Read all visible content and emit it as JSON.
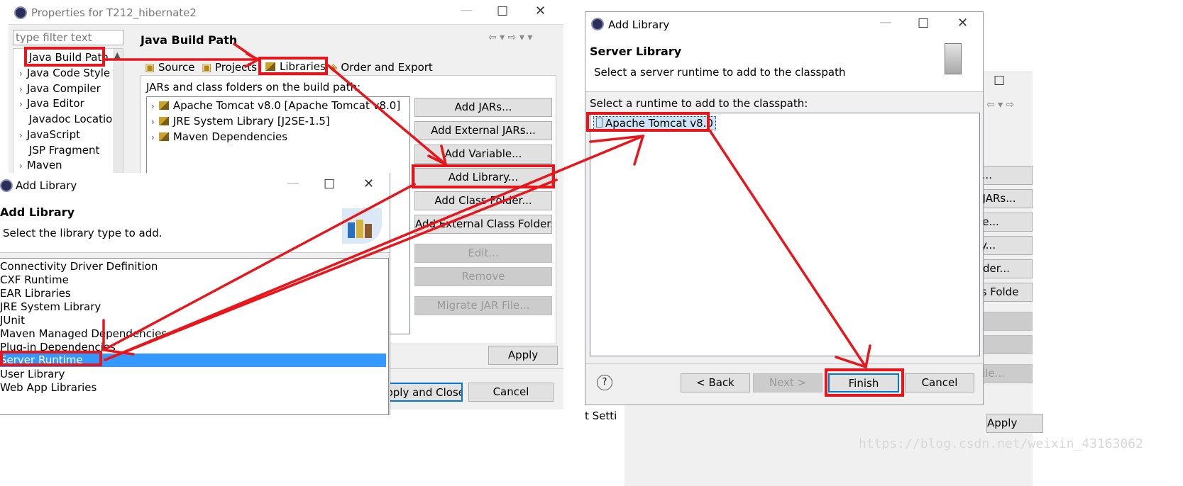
{
  "properties": {
    "title": "Properties for T212_hibernate2",
    "filter_placeholder": "type filter text",
    "nav_items": [
      "Java Build Path",
      "Java Code Style",
      "Java Compiler",
      "Java Editor",
      "Javadoc Locatior",
      "JavaScript",
      "JSP Fragment",
      "Maven"
    ],
    "section_title": "Java Build Path",
    "tabs": [
      "Source",
      "Projects",
      "Libraries",
      "Order and Export"
    ],
    "jars_label": "JARs and class folders on the build path:",
    "tree": [
      "Apache Tomcat v8.0 [Apache Tomcat v8.0]",
      "JRE System Library [J2SE-1.5]",
      "Maven Dependencies"
    ],
    "buttons": [
      "Add JARs...",
      "Add External JARs...",
      "Add Variable...",
      "Add Library...",
      "Add Class Folder...",
      "Add External Class Folder...",
      "Edit...",
      "Remove",
      "Migrate JAR File..."
    ],
    "apply": "Apply",
    "apply_close": "Apply and Close",
    "cancel": "Cancel"
  },
  "add_library": {
    "title": "Add Library",
    "heading": "Add Library",
    "subtitle": "Select the library type to add.",
    "items": [
      "Connectivity Driver Definition",
      "CXF Runtime",
      "EAR Libraries",
      "JRE System Library",
      "JUnit",
      "Maven Managed Dependencies",
      "Plug-in Dependencies",
      "Server Runtime",
      "User Library",
      "Web App Libraries"
    ],
    "selected": "Server Runtime"
  },
  "server_library": {
    "title": "Add Library",
    "heading": "Server Library",
    "subtitle": "Select a server runtime to add to the classpath",
    "list_label": "Select a runtime to add to the classpath:",
    "runtime": "Apache Tomcat v8.0",
    "back": "< Back",
    "next": "Next >",
    "finish": "Finish",
    "cancel": "Cancel",
    "help": "?"
  },
  "background_window": {
    "buttons": [
      "JARs...",
      "rnal JARs...",
      "riable...",
      "brary...",
      "s Folder...",
      "Class Folde",
      "t...",
      "ove",
      "AR File..."
    ],
    "apply": "Apply",
    "setting": "t Setti"
  },
  "watermark": "https://blog.csdn.net/weixin_43163062",
  "colors": {
    "highlight": "#e8151b",
    "selection": "#3399ff",
    "default_border": "#0078d7"
  }
}
